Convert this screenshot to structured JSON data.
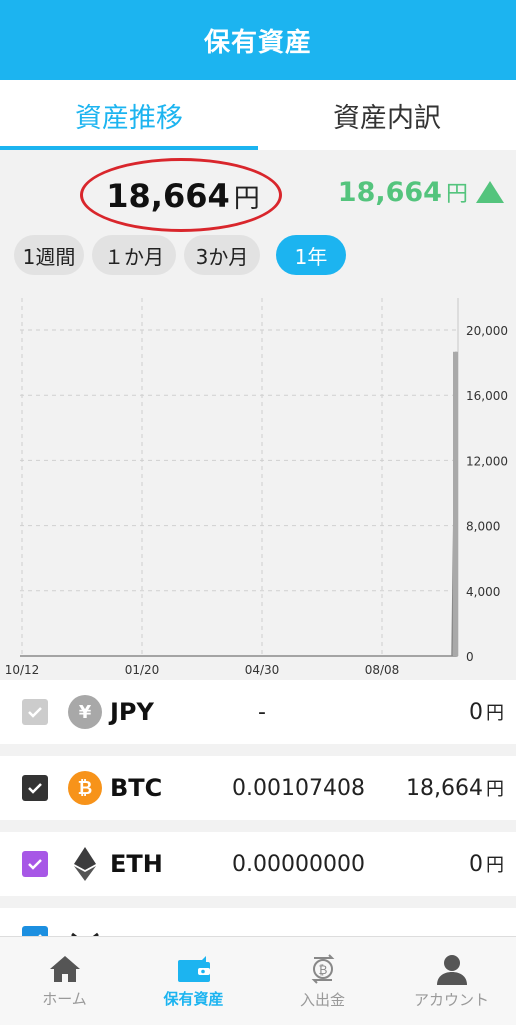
{
  "header": {
    "title": "保有資産"
  },
  "tabs": [
    {
      "label": "資産推移",
      "active": true
    },
    {
      "label": "資産内訳",
      "active": false
    }
  ],
  "summary": {
    "total": "18,664",
    "total_unit": "円",
    "change": "18,664",
    "change_unit": "円",
    "change_direction": "up"
  },
  "periods": [
    {
      "label": "1週間"
    },
    {
      "label": "１か月"
    },
    {
      "label": "3か月"
    },
    {
      "label": "1年",
      "active": true
    }
  ],
  "chart_data": {
    "type": "area",
    "x_ticks": [
      "10/12",
      "01/20",
      "04/30",
      "08/08"
    ],
    "y_ticks": [
      "20,000",
      "16,000",
      "12,000",
      "8,000",
      "4,000",
      "0"
    ],
    "ylim": [
      0,
      20000
    ],
    "series": [
      {
        "values": [
          0,
          0,
          0,
          0,
          0,
          0,
          18664
        ]
      }
    ],
    "grid": true
  },
  "assets": [
    {
      "symbol": "JPY",
      "icon": "yen-coin-icon",
      "quantity": "-",
      "amount": "0",
      "unit": "円",
      "checked": true,
      "check_color": "#cccccc",
      "coin_color": "#a8a8a8",
      "coin_glyph": "¥"
    },
    {
      "symbol": "BTC",
      "icon": "bitcoin-icon",
      "quantity": "0.00107408",
      "amount": "18,664",
      "unit": "円",
      "checked": true,
      "check_color": "#333333",
      "coin_color": "#f7931a",
      "coin_glyph": "₿"
    },
    {
      "symbol": "ETH",
      "icon": "ethereum-icon",
      "quantity": "0.00000000",
      "amount": "0",
      "unit": "円",
      "checked": true,
      "check_color": "#a757e6",
      "coin_color": "",
      "coin_glyph": ""
    }
  ],
  "nav": [
    {
      "label": "ホーム",
      "icon": "home-icon"
    },
    {
      "label": "保有資産",
      "icon": "wallet-icon",
      "active": true
    },
    {
      "label": "入出金",
      "icon": "transfer-icon"
    },
    {
      "label": "アカウント",
      "icon": "account-icon"
    }
  ]
}
